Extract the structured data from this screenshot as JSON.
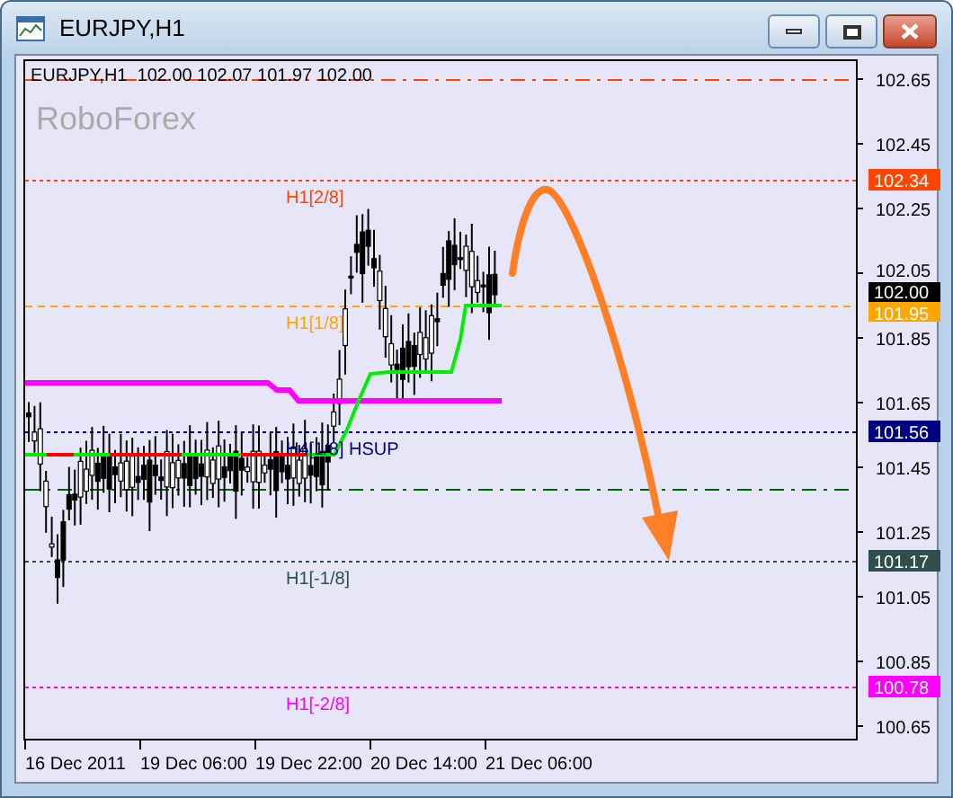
{
  "window": {
    "title": "EURJPY,H1"
  },
  "chart": {
    "header": "EURJPY,H1  102.00 102.07 101.97 102.00",
    "watermark": "RoboForex",
    "y_ticks": [
      "102.65",
      "102.45",
      "102.25",
      "102.05",
      "101.85",
      "101.65",
      "101.45",
      "101.25",
      "101.05",
      "100.85",
      "100.65"
    ],
    "x_ticks": [
      "16 Dec 2011",
      "19 Dec 06:00",
      "19 Dec 22:00",
      "20 Dec 14:00",
      "21 Dec 06:00"
    ],
    "levels": [
      {
        "kind": "dashdot",
        "color": "#ff4500"
      },
      {
        "kind": "dotted",
        "label": "H1[2/8]",
        "tag": "102.34",
        "color": "#ff4500"
      },
      {
        "kind": "dashed",
        "label": "H1[1/8]",
        "tag": "101.95",
        "color": "#ffa500"
      },
      {
        "kind": "dotted",
        "label": "H4[1/8] HSUP",
        "tag": "101.56",
        "color": "#000080"
      },
      {
        "kind": "dashdot",
        "color": "#006400"
      },
      {
        "kind": "dotted",
        "label": "H1[-1/8]",
        "tag": "101.17",
        "color": "#2f4f4f"
      },
      {
        "kind": "dotted",
        "label": "H1[-2/8]",
        "tag": "100.78",
        "color": "#ff00ff"
      }
    ],
    "current_price": {
      "tag": "102.00",
      "color": "#000000"
    }
  }
}
